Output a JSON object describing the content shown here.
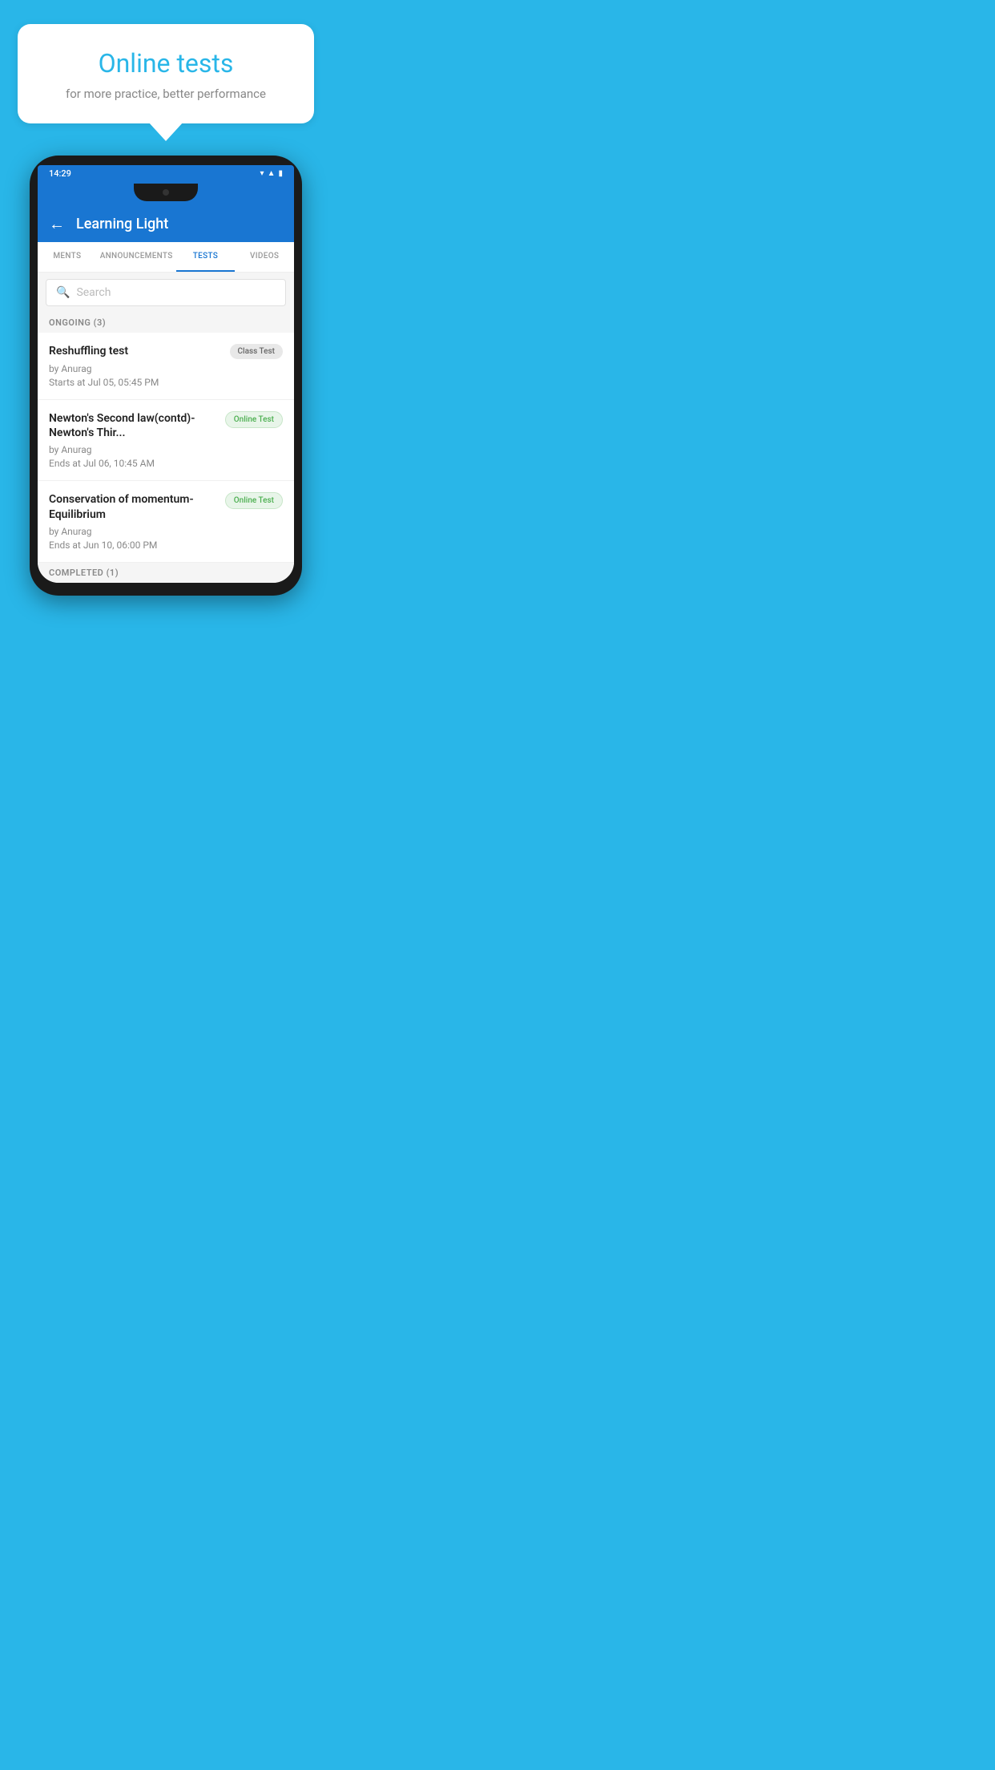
{
  "background_color": "#29B6E8",
  "speech_bubble": {
    "title": "Online tests",
    "subtitle": "for more practice, better performance"
  },
  "status_bar": {
    "time": "14:29",
    "icons": [
      "wifi",
      "signal",
      "battery"
    ]
  },
  "app_bar": {
    "title": "Learning Light",
    "back_label": "←"
  },
  "tabs": [
    {
      "label": "MENTS",
      "active": false
    },
    {
      "label": "ANNOUNCEMENTS",
      "active": false
    },
    {
      "label": "TESTS",
      "active": true
    },
    {
      "label": "VIDEOS",
      "active": false
    }
  ],
  "search": {
    "placeholder": "Search"
  },
  "sections": [
    {
      "header": "ONGOING (3)",
      "items": [
        {
          "title": "Reshuffling test",
          "badge": "Class Test",
          "badge_type": "class",
          "author": "by Anurag",
          "date": "Starts at  Jul 05, 05:45 PM"
        },
        {
          "title": "Newton's Second law(contd)-Newton's Thir...",
          "badge": "Online Test",
          "badge_type": "online",
          "author": "by Anurag",
          "date": "Ends at  Jul 06, 10:45 AM"
        },
        {
          "title": "Conservation of momentum-Equilibrium",
          "badge": "Online Test",
          "badge_type": "online",
          "author": "by Anurag",
          "date": "Ends at  Jun 10, 06:00 PM"
        }
      ]
    },
    {
      "header": "COMPLETED (1)",
      "items": []
    }
  ]
}
